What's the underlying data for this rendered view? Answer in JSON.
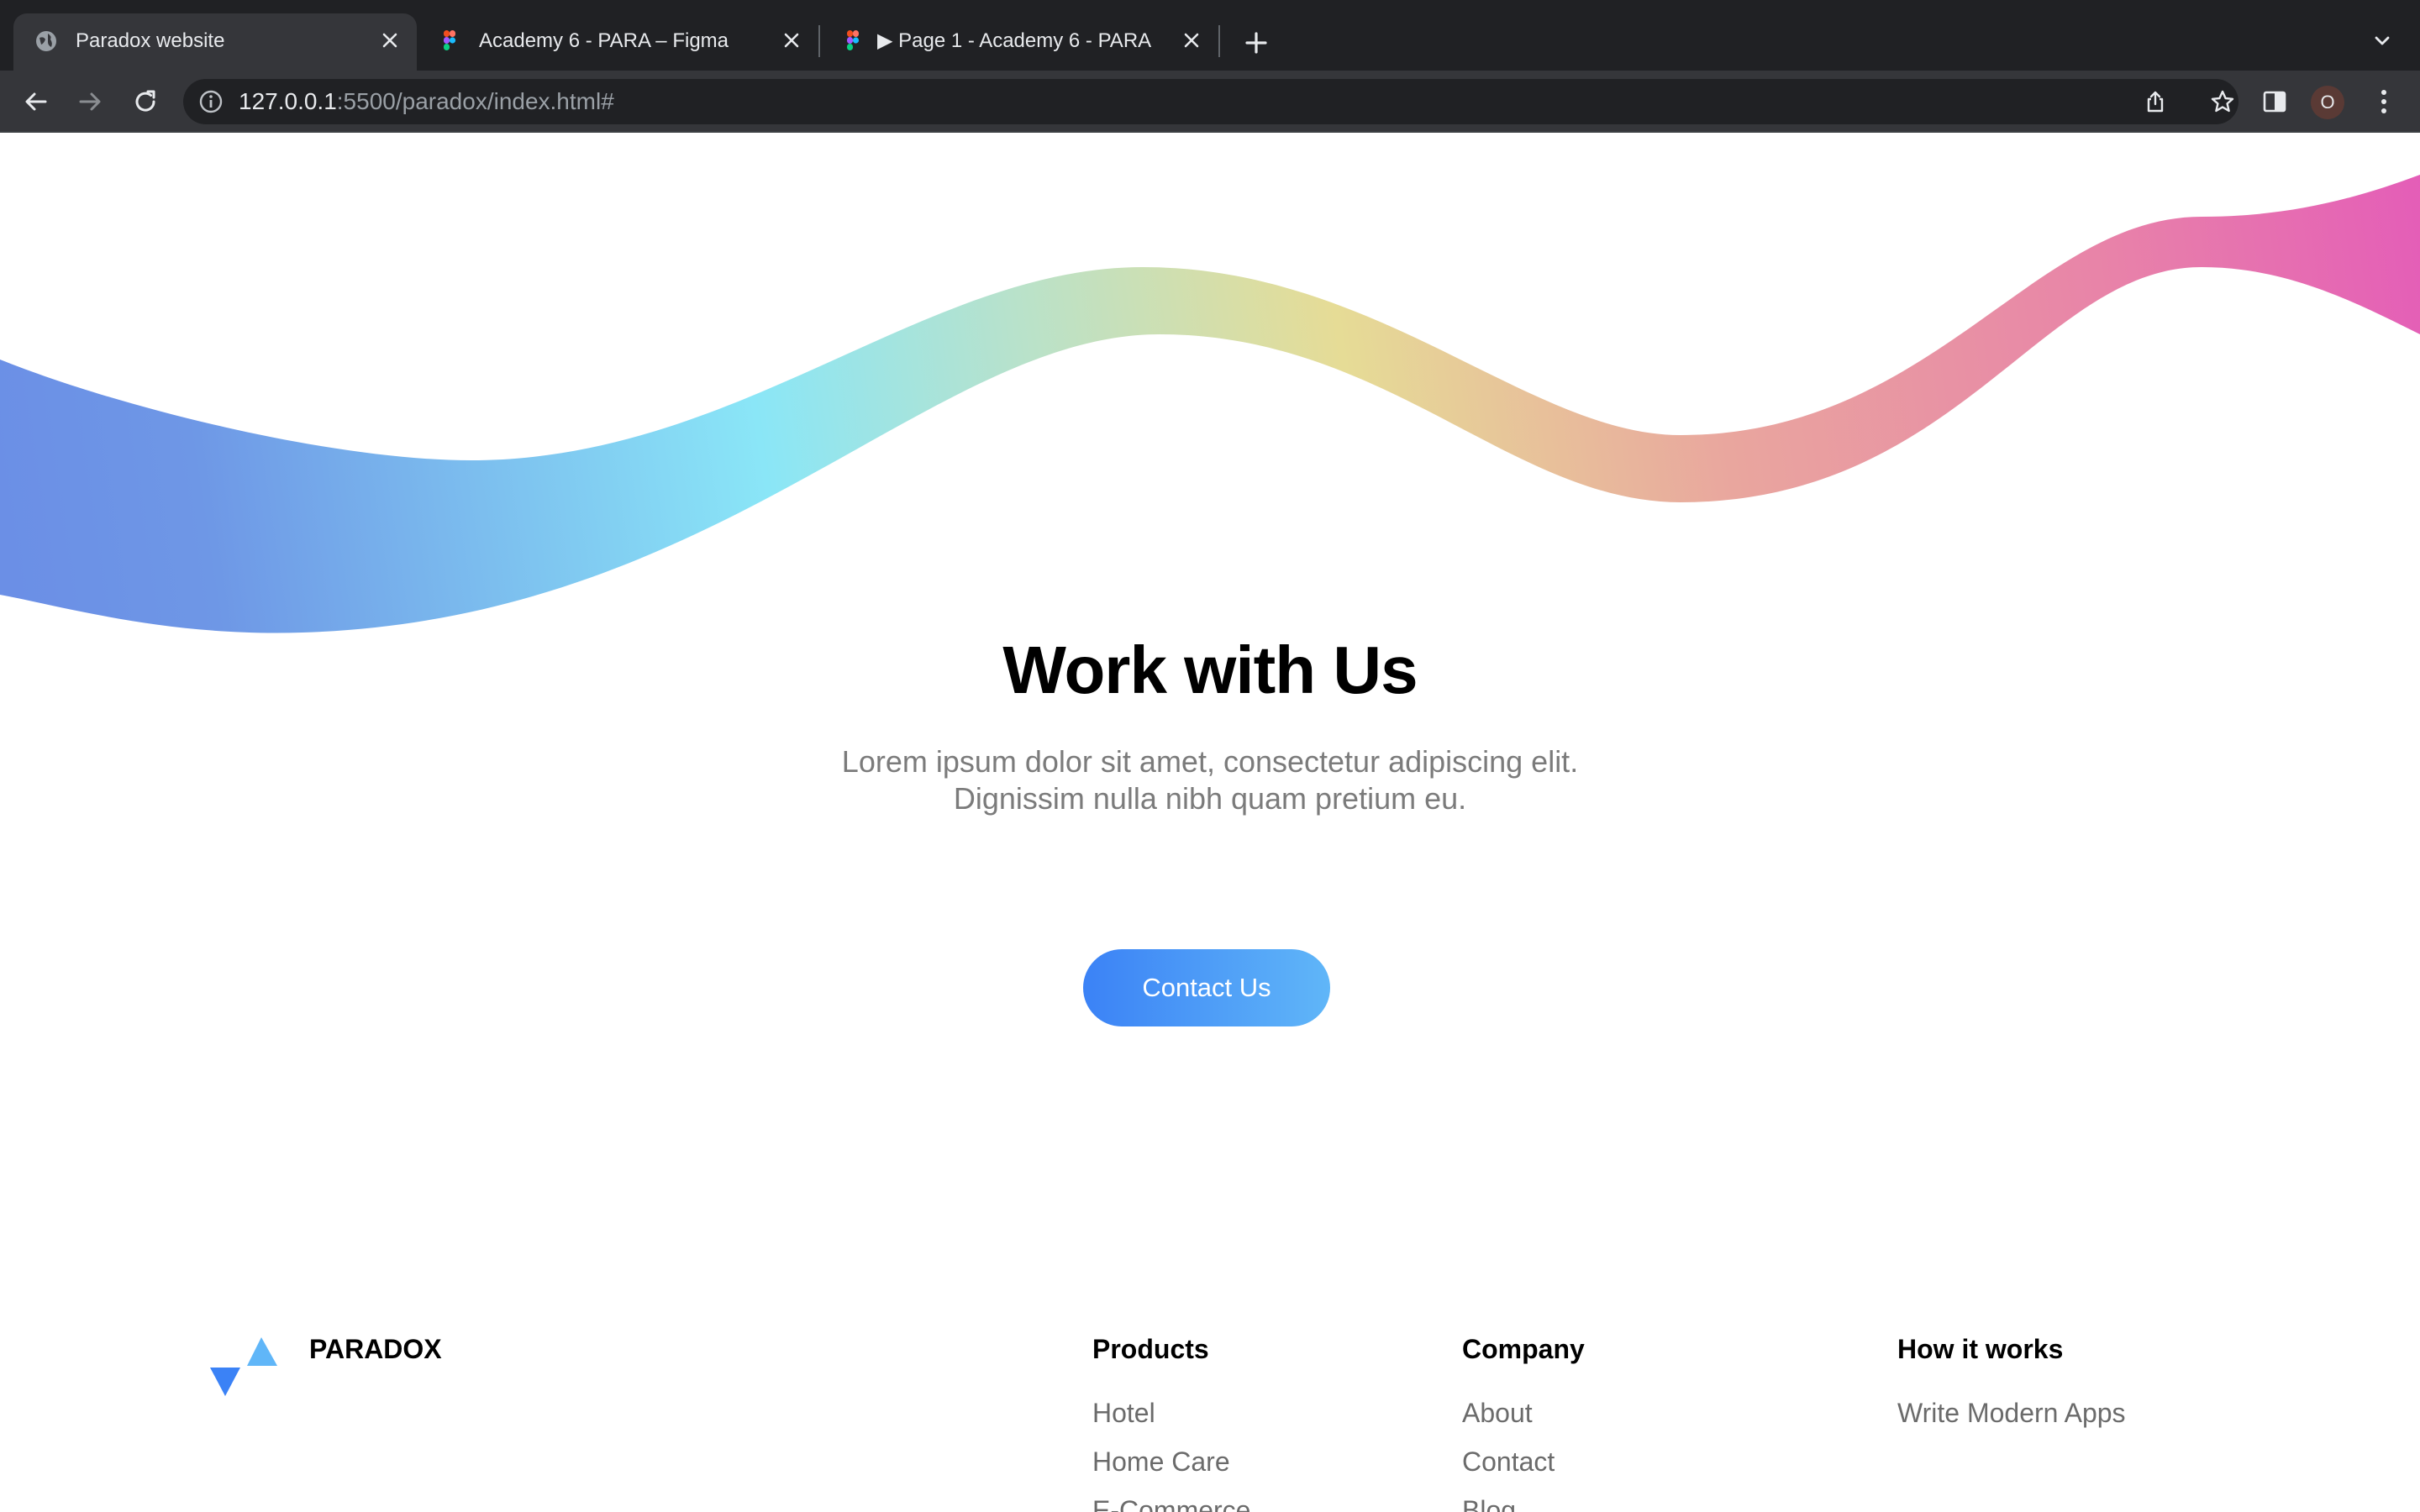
{
  "browser": {
    "tabs": [
      {
        "title": "Paradox website",
        "active": true,
        "favicon": "globe-icon"
      },
      {
        "title": "Academy 6 - PARA – Figma",
        "active": false,
        "favicon": "figma-icon"
      },
      {
        "title": "▶ Page 1 - Academy 6 - PARA",
        "active": false,
        "favicon": "figma-icon"
      }
    ],
    "url_host": "127.0.0.1",
    "url_rest": ":5500/paradox/index.html#",
    "profile_initial": "O"
  },
  "hero": {
    "title": "Work with Us",
    "subtitle_line1": "Lorem ipsum dolor sit amet, consectetur adipiscing elit.",
    "subtitle_line2": "Dignissim nulla nibh quam pretium eu.",
    "cta_label": "Contact Us"
  },
  "footer": {
    "brand": "PARADOX",
    "columns": [
      {
        "title": "Products",
        "links": [
          "Hotel",
          "Home Care",
          "E-Commerce"
        ]
      },
      {
        "title": "Company",
        "links": [
          "About",
          "Contact",
          "Blog"
        ]
      },
      {
        "title": "How it works",
        "links": [
          "Write Modern Apps"
        ]
      }
    ]
  },
  "colors": {
    "chrome_dark": "#202124",
    "chrome_mid": "#35363a",
    "button_start": "#3b82f6",
    "button_end": "#60b6f8",
    "wave_colors": [
      "#6b8fe6",
      "#8ae6f7",
      "#e6dc96",
      "#e9a69e",
      "#e45cb8"
    ]
  }
}
